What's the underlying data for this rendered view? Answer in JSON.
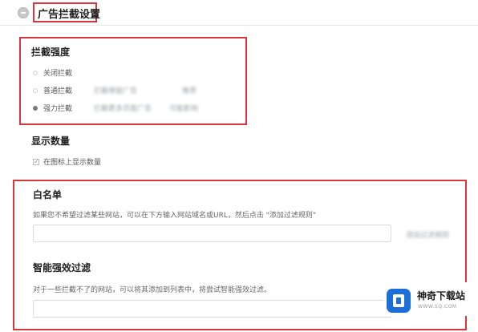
{
  "header": {
    "title": "广告拦截设置",
    "icon": "collapse-icon"
  },
  "block_strength": {
    "title": "拦截强度",
    "options": [
      {
        "label": "关闭拦截",
        "desc": "",
        "note": "",
        "selected": false
      },
      {
        "label": "普通拦截",
        "desc": "拦截弹窗广告",
        "note": "推荐",
        "selected": false
      },
      {
        "label": "强力拦截",
        "desc": "拦截更多页面广告",
        "note": "可能影响",
        "selected": true
      }
    ]
  },
  "display_count": {
    "title": "显示数量",
    "checkbox_label": "在图标上显示数量",
    "checked": true
  },
  "whitelist": {
    "title": "白名单",
    "description": "如果您不希望过滤某些网站，可以在下方输入网站域名或URL，然后点击 \"添加过滤规则\"",
    "input_value": "",
    "add_button": "添加过滤规则"
  },
  "smart_filter": {
    "title": "智能强效过滤",
    "description": "对于一些拦截不了的网站，可以将其添加到列表中，将尝试智能强效过滤。",
    "input_value": ""
  },
  "watermark": {
    "name": "神奇下载站",
    "url": "WWW.SQ.COM"
  },
  "colors": {
    "highlight": "#d9373d",
    "brand": "#1d6fd8"
  }
}
